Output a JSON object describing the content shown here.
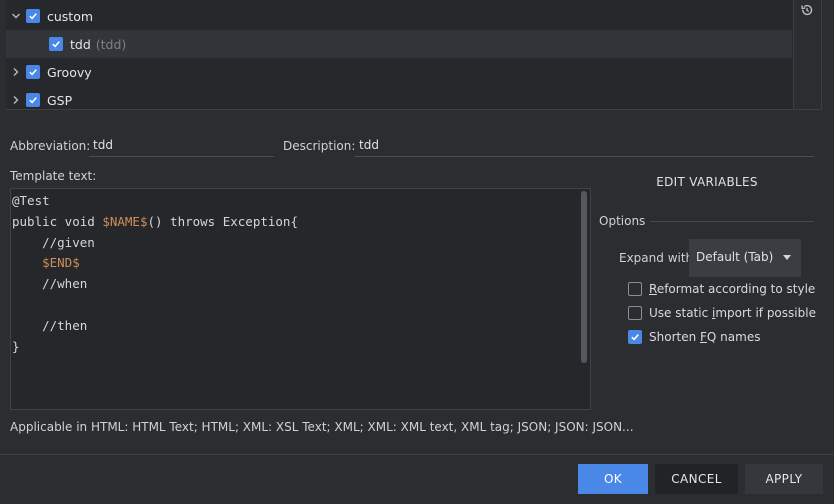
{
  "tree": {
    "items": [
      {
        "label": "custom",
        "expanded": true,
        "checked": true
      },
      {
        "label": "tdd",
        "sub": "(tdd)",
        "checked": true,
        "selected": true
      },
      {
        "label": "Groovy",
        "expanded": false,
        "checked": true
      },
      {
        "label": "GSP",
        "expanded": false,
        "checked": true
      }
    ],
    "restore_icon": "restore-icon"
  },
  "fields": {
    "abbreviation_label": "Abbreviation:",
    "abbreviation_value": "tdd",
    "description_label": "Description:",
    "description_value": "tdd",
    "template_label": "Template text:"
  },
  "code": {
    "lines": [
      "@Test",
      "public void $NAME$() throws Exception{",
      "    //given",
      "    $END$",
      "    //when",
      "",
      "    //then",
      "}"
    ]
  },
  "applicable_text": "Applicable in HTML: HTML Text; HTML; XML: XSL Text; XML; XML: XML text, XML tag; JSON; JSON: JSON...",
  "options": {
    "edit_variables_label": "EDIT VARIABLES",
    "title": "Options",
    "expand_label": "Expand with",
    "expand_value": "Default (Tab)",
    "reformat_pre": "",
    "reformat_ul": "R",
    "reformat_post": "eformat according to style",
    "reformat_checked": false,
    "static_pre": "Use static ",
    "static_ul": "i",
    "static_post": "mport if possible",
    "static_checked": false,
    "shorten_pre": "Shorten ",
    "shorten_ul": "F",
    "shorten_post": "Q names",
    "shorten_checked": true
  },
  "buttons": {
    "ok": "OK",
    "cancel": "CANCEL",
    "apply": "APPLY"
  },
  "colors": {
    "accent": "#4a88e8",
    "background": "#2b2d30",
    "variable": "#cf8e5a"
  }
}
